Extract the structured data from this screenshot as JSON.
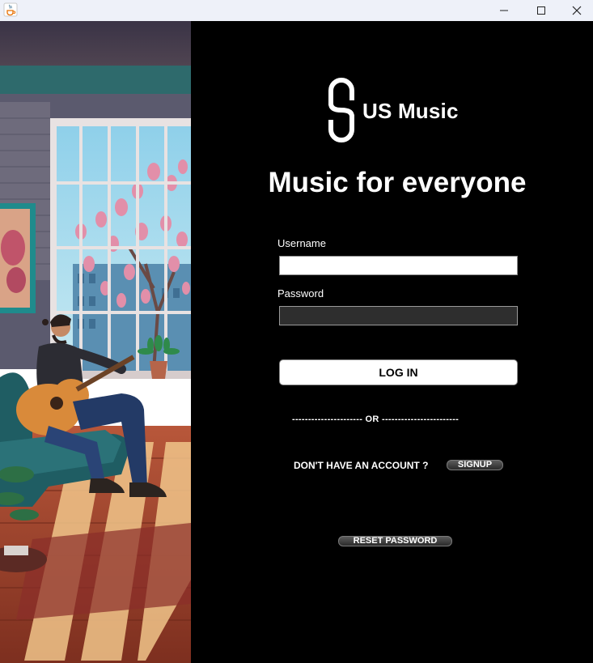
{
  "window": {
    "app_icon": "java-coffee-cup-icon",
    "controls": [
      "minimize-icon",
      "maximize-icon",
      "close-icon"
    ]
  },
  "illustration": {
    "description_icon": "guitarist-illustration"
  },
  "brand": {
    "logo_icon": "us-music-logo-icon",
    "name": "US Music",
    "tagline": "Music for everyone"
  },
  "form": {
    "username_label": "Username",
    "username_value": "",
    "password_label": "Password",
    "password_value": "",
    "login_label": "LOG IN"
  },
  "divider": {
    "text": "---------------------- OR ------------------------"
  },
  "signup": {
    "prompt": "DON'T HAVE AN ACCOUNT ?",
    "button_label": "SIGNUP"
  },
  "reset": {
    "button_label": "RESET PASSWORD"
  },
  "colors": {
    "panel_background": "#000000",
    "titlebar_background": "#eef1f9",
    "text": "#ffffff"
  }
}
